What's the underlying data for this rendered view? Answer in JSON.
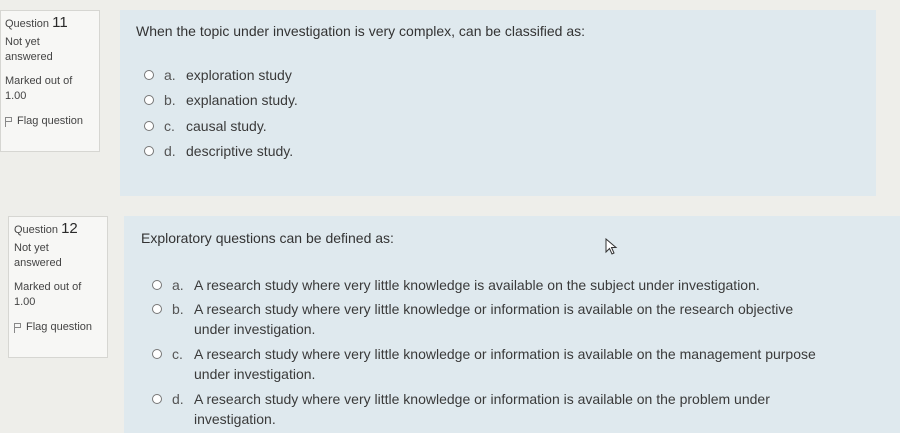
{
  "questions": [
    {
      "label": "Question",
      "number": "11",
      "status": "Not yet answered",
      "marked": "Marked out of 1.00",
      "flag": "Flag question",
      "text": "When the topic under investigation is very complex, can be classified as:",
      "options": [
        {
          "letter": "a.",
          "text": "exploration study"
        },
        {
          "letter": "b.",
          "text": "explanation study."
        },
        {
          "letter": "c.",
          "text": "causal study."
        },
        {
          "letter": "d.",
          "text": "descriptive study."
        }
      ]
    },
    {
      "label": "Question",
      "number": "12",
      "status": "Not yet answered",
      "marked": "Marked out of 1.00",
      "flag": "Flag question",
      "text": "Exploratory questions can be defined as:",
      "options": [
        {
          "letter": "a.",
          "text": "A research study where very little knowledge is available on the subject under investigation."
        },
        {
          "letter": "b.",
          "text": "A research study where very little knowledge or information is available on the research objective under investigation."
        },
        {
          "letter": "c.",
          "text": "A research study where very little knowledge or information is available on the management purpose under investigation."
        },
        {
          "letter": "d.",
          "text": "A research study where very little knowledge or information is available on the problem under investigation."
        }
      ]
    }
  ]
}
